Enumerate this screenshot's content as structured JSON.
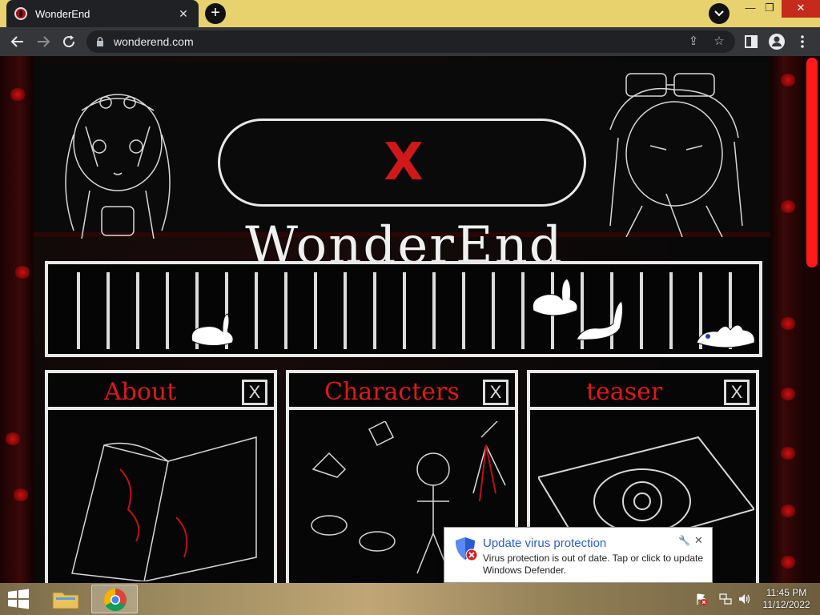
{
  "browser": {
    "tab_title": "WonderEnd",
    "tab_close": "✕",
    "new_tab": "+",
    "url": "wonderend.com",
    "window_minimize": "—",
    "window_restore": "❐",
    "window_close": "✕"
  },
  "site": {
    "logo_x_left": "X",
    "logo_text": "WonderEnd",
    "logo_x_right": "X",
    "panels": [
      {
        "title": "About",
        "close": "X"
      },
      {
        "title": "Characters",
        "close": "X"
      },
      {
        "title": "teaser",
        "close": "X"
      }
    ]
  },
  "toast": {
    "title": "Update virus protection",
    "body": "Virus protection is out of date. Tap or click to update Windows Defender.",
    "close": "✕"
  },
  "taskbar": {
    "time": "11:45 PM",
    "date": "11/12/2022"
  },
  "colors": {
    "accent_red": "#e01818",
    "chalk": "#e8e8e8",
    "tab_bar": "#e8d26e",
    "toast_title": "#2a5bd7"
  }
}
